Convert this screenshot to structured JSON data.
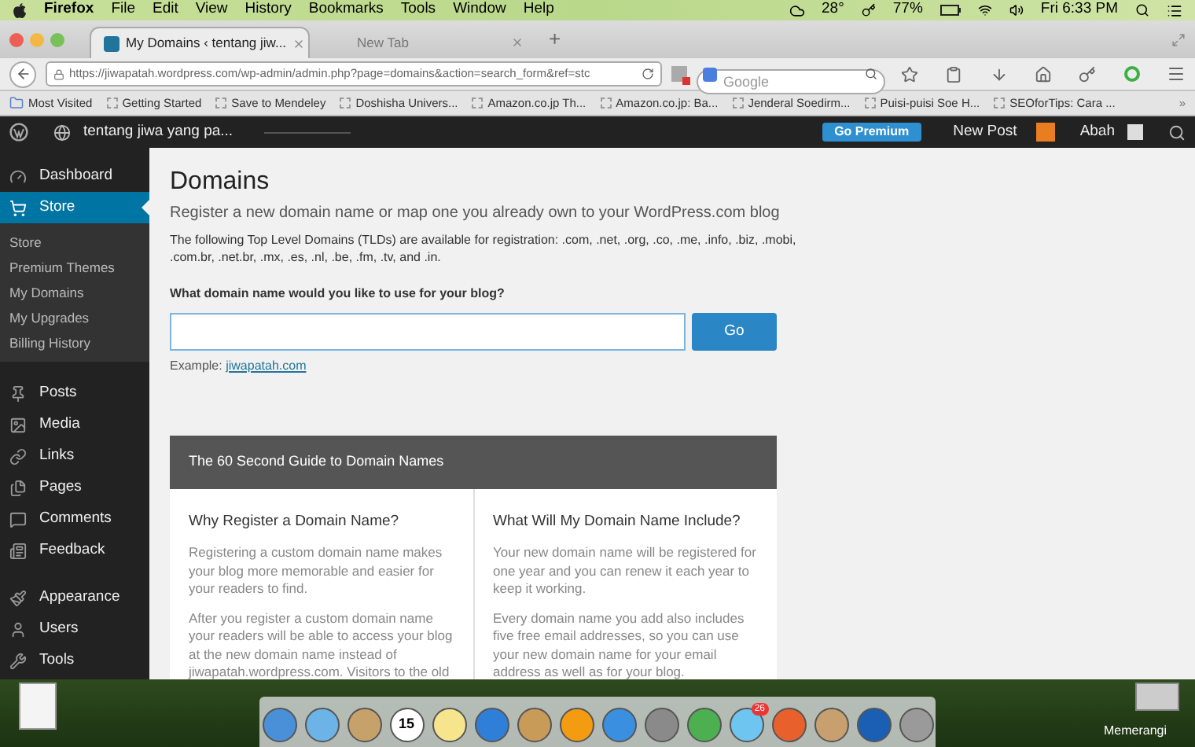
{
  "menubar": {
    "app": "Firefox",
    "items": [
      "File",
      "Edit",
      "View",
      "History",
      "Bookmarks",
      "Tools",
      "Window",
      "Help"
    ],
    "temperature": "28°",
    "battery": "77%",
    "clock": "Fri 6:33 PM"
  },
  "tabs": [
    {
      "label": "My Domains ‹ tentang jiw...",
      "selected": true
    },
    {
      "label": "New Tab",
      "selected": false
    }
  ],
  "new_tab": "+",
  "url_bar": {
    "value": "https://jiwapatah.wordpress.com/wp-admin/admin.php?page=domains&action=search_form&ref=stc"
  },
  "search": {
    "placeholder": "Google"
  },
  "bookmarks": [
    "Most Visited",
    "Getting Started",
    "Save to Mendeley",
    "Doshisha Univers...",
    "Amazon.co.jp Th...",
    "Amazon.co.jp: Ba...",
    "Jenderal Soedirm...",
    "Puisi-puisi Soe H...",
    "SEOforTips: Cara ..."
  ],
  "bookmarks_more": "»",
  "admin_bar": {
    "site": "tentang jiwa yang pa...",
    "premium": "Go Premium",
    "new_post": "New Post",
    "user": "Abah"
  },
  "sidebar": {
    "groups": [
      [
        {
          "label": "Dashboard",
          "selected": false
        },
        {
          "label": "Store",
          "selected": true,
          "children": [
            {
              "label": "Store",
              "selected": false
            },
            {
              "label": "Premium Themes",
              "selected": false
            },
            {
              "label": "My Domains",
              "selected": false
            },
            {
              "label": "My Upgrades",
              "selected": false
            },
            {
              "label": "Billing History",
              "selected": false
            }
          ]
        }
      ],
      [
        {
          "label": "Posts",
          "selected": false
        },
        {
          "label": "Media",
          "selected": false
        },
        {
          "label": "Links",
          "selected": false
        },
        {
          "label": "Pages",
          "selected": false
        },
        {
          "label": "Comments",
          "selected": false
        },
        {
          "label": "Feedback",
          "selected": false
        }
      ],
      [
        {
          "label": "Appearance",
          "selected": false
        },
        {
          "label": "Users",
          "selected": false
        },
        {
          "label": "Tools",
          "selected": false
        }
      ]
    ]
  },
  "page": {
    "title": "Domains",
    "subtitle": "Register a new domain name or map one you already own to your WordPress.com blog",
    "tlds": "The following Top Level Domains (TLDs) are available for registration: .com, .net, .org, .co, .me, .info, .biz, .mobi, .com.br, .net.br, .mx, .es, .nl, .be, .fm, .tv, and .in.",
    "question": "What domain name would you like to use for your blog?",
    "go": "Go",
    "example_label": "Example:",
    "example_link": "jiwapatah.com"
  },
  "guide": {
    "title": "The 60 Second Guide to Domain Names",
    "columns": [
      {
        "heading": "Why Register a Domain Name?",
        "paragraphs": [
          "Registering a custom domain name makes your blog more memorable and easier for your readers to find.",
          "After you register a custom domain name your readers will be able to access your blog at the new domain name instead of jiwapatah.wordpress.com. Visitors to the old"
        ]
      },
      {
        "heading": "What Will My Domain Name Include?",
        "paragraphs": [
          "Your new domain name will be registered for one year and you can renew it each year to keep it working.",
          "Every domain name you add also includes five free email addresses, so you can use your new domain name for your email address as well as for your blog."
        ]
      }
    ]
  },
  "dock": {
    "calendar_day": "15",
    "weather_badge": "26",
    "desktop_file": "Memerangi"
  }
}
